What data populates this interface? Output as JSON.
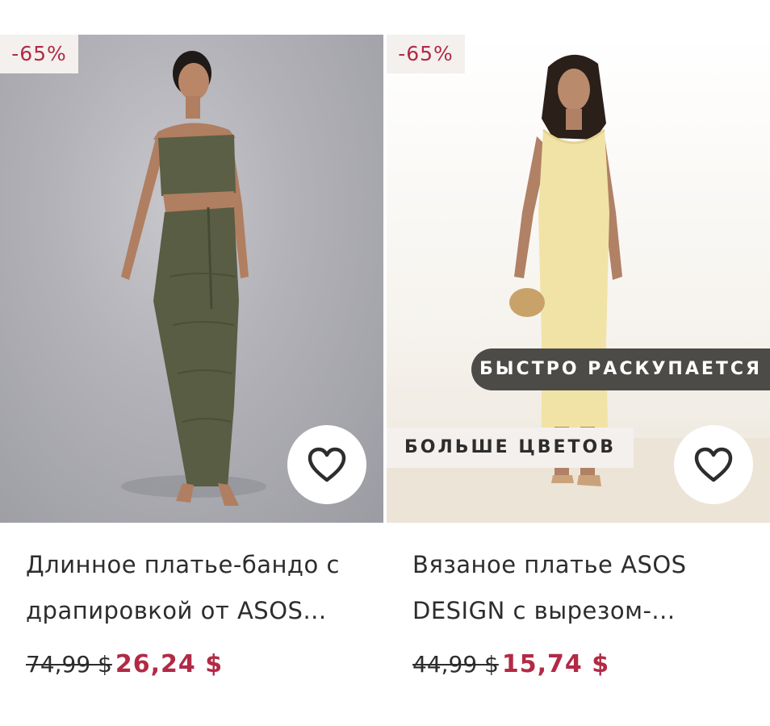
{
  "products": [
    {
      "discount": "-65%",
      "title_line1": "Длинное платье-бандо с",
      "title_line2": "драпировкой от ASOS...",
      "old_price": "74,99 $",
      "new_price": "26,24 $"
    },
    {
      "discount": "-65%",
      "badge_selling": "БЫСТРО РАСКУПАЕТСЯ",
      "badge_colors": "БОЛЬШЕ ЦВЕТОВ",
      "title_line1": "Вязаное платье ASOS",
      "title_line2": "DESIGN с вырезом-...",
      "old_price": "44,99 $",
      "new_price": "15,74 $"
    }
  ],
  "colors": {
    "sale_red": "#b22a45",
    "text_dark": "#2d2d2d",
    "badge_dark": "#4d4b48",
    "badge_light": "#f3f0ee"
  },
  "icons": {
    "wishlist": "heart-outline-icon"
  }
}
